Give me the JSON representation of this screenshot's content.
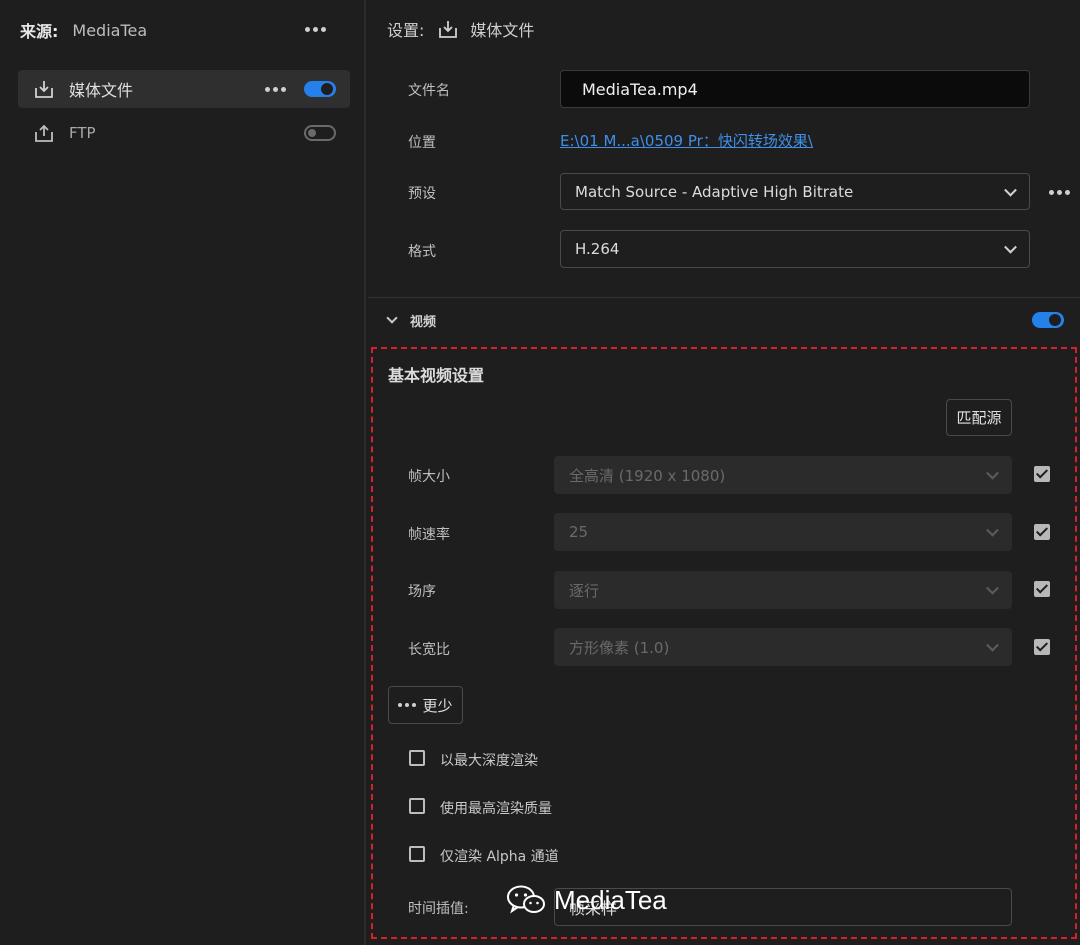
{
  "source": {
    "label": "来源:",
    "name": "MediaTea"
  },
  "destinations": [
    {
      "label": "媒体文件",
      "icon": "download-icon",
      "enabled": true,
      "selected": true
    },
    {
      "label": "FTP",
      "icon": "upload-icon",
      "enabled": false,
      "selected": false
    }
  ],
  "settings": {
    "title": "设置:",
    "target": "媒体文件",
    "filename_label": "文件名",
    "filename_value": "MediaTea.mp4",
    "location_label": "位置",
    "location_value": "E:\\01 M...a\\0509 Pr：快闪转场效果\\",
    "preset_label": "预设",
    "preset_value": "Match Source - Adaptive High Bitrate",
    "format_label": "格式",
    "format_value": "H.264"
  },
  "video": {
    "section_title": "视频",
    "enabled": true,
    "basic_title": "基本视频设置",
    "match_source_button": "匹配源",
    "fields": [
      {
        "label": "帧大小",
        "value": "全高清 (1920 x 1080)",
        "checked": true
      },
      {
        "label": "帧速率",
        "value": "25",
        "checked": true
      },
      {
        "label": "场序",
        "value": "逐行",
        "checked": true
      },
      {
        "label": "长宽比",
        "value": "方形像素 (1.0)",
        "checked": true
      }
    ],
    "less_button": "更少",
    "options": [
      {
        "label": "以最大深度渲染",
        "checked": false
      },
      {
        "label": "使用最高渲染质量",
        "checked": false
      },
      {
        "label": "仅渲染 Alpha 通道",
        "checked": false
      }
    ],
    "time_interp_label": "时间插值:",
    "time_interp_value": "帧采样"
  },
  "watermark": {
    "text": "MediaTea"
  },
  "colors": {
    "accent": "#2680eb",
    "highlight_border": "#d8202a",
    "link": "#3f8fe8"
  }
}
